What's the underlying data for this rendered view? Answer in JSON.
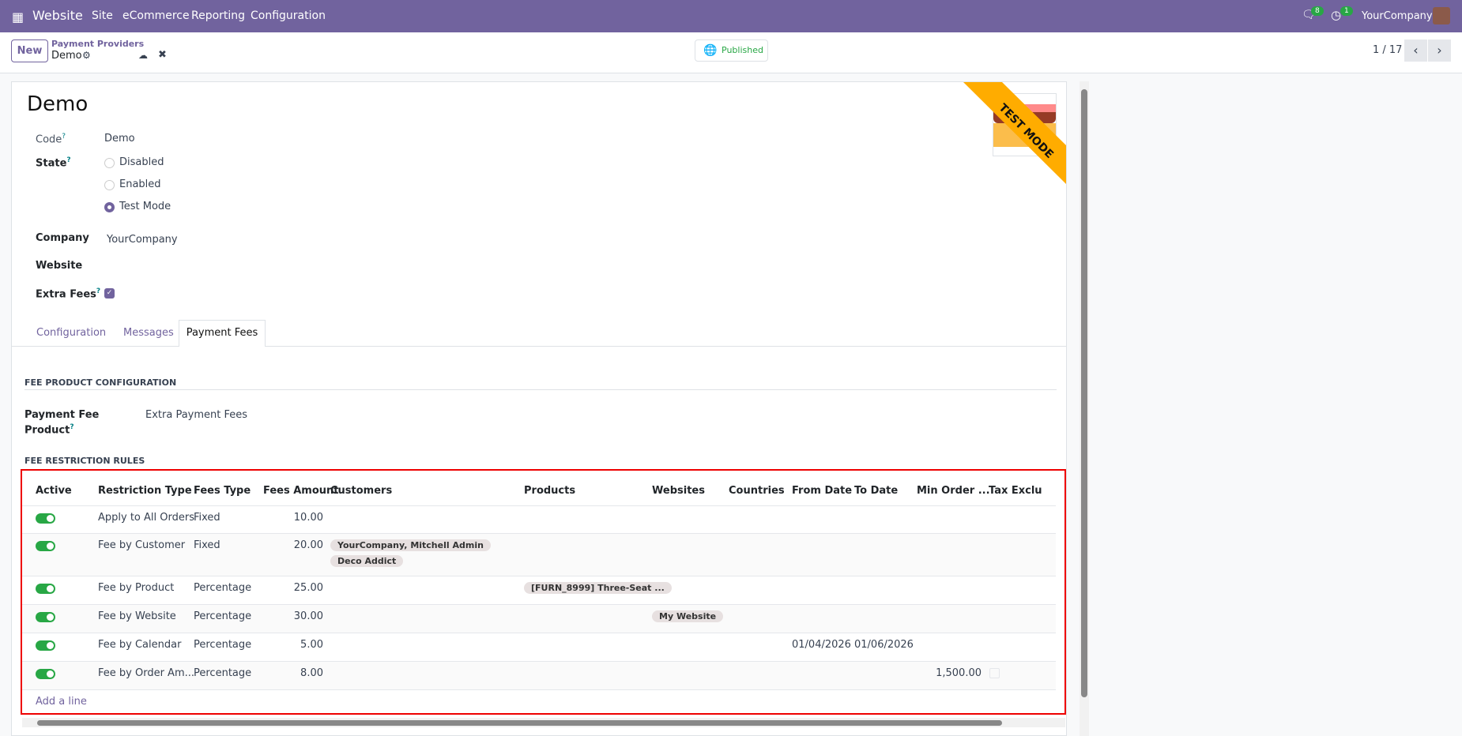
{
  "navbar": {
    "app": "Website",
    "menu": [
      "Site",
      "eCommerce",
      "Reporting",
      "Configuration"
    ],
    "messages_count": "8",
    "activities_count": "1",
    "company": "YourCompany"
  },
  "control": {
    "new_label": "New",
    "breadcrumb_parent": "Payment Providers",
    "breadcrumb_current": "Demo",
    "published_label": "Published",
    "pager": "1 / 17"
  },
  "form": {
    "title": "Demo",
    "ribbon": "TEST MODE",
    "code_label": "Code",
    "code_value": "Demo",
    "state_label": "State",
    "state_options": [
      "Disabled",
      "Enabled",
      "Test Mode"
    ],
    "state_selected": "Test Mode",
    "company_label": "Company",
    "company_value": "YourCompany",
    "website_label": "Website",
    "extra_fees_label": "Extra Fees",
    "extra_fees_checked": true,
    "tabs": [
      "Configuration",
      "Messages",
      "Payment Fees"
    ],
    "active_tab": "Payment Fees",
    "fee_product_section": "FEE PRODUCT CONFIGURATION",
    "payment_fee_label_1": "Payment Fee",
    "payment_fee_label_2": "Product",
    "payment_fee_value": "Extra Payment Fees",
    "rules_section": "FEE RESTRICTION RULES"
  },
  "table": {
    "headers": [
      "Active",
      "Restriction Type",
      "Fees Type",
      "Fees Amount",
      "Customers",
      "Products",
      "Websites",
      "Countries",
      "From Date",
      "To Date",
      "Min Order ...",
      "Tax Exclu"
    ],
    "rows": [
      {
        "active": true,
        "type": "Apply to All Orders",
        "fees_type": "Fixed",
        "amount": "10.00",
        "customers": [],
        "products": [],
        "websites": [],
        "from": "",
        "to": "",
        "min": "",
        "tax": false
      },
      {
        "active": true,
        "type": "Fee by Customer",
        "fees_type": "Fixed",
        "amount": "20.00",
        "customers": [
          "YourCompany, Mitchell Admin",
          "Deco Addict"
        ],
        "products": [],
        "websites": [],
        "from": "",
        "to": "",
        "min": "",
        "tax": false
      },
      {
        "active": true,
        "type": "Fee by Product",
        "fees_type": "Percentage",
        "amount": "25.00",
        "customers": [],
        "products": [
          "[FURN_8999] Three-Seat ..."
        ],
        "websites": [],
        "from": "",
        "to": "",
        "min": "",
        "tax": false
      },
      {
        "active": true,
        "type": "Fee by Website",
        "fees_type": "Percentage",
        "amount": "30.00",
        "customers": [],
        "products": [],
        "websites": [
          "My Website"
        ],
        "from": "",
        "to": "",
        "min": "",
        "tax": false
      },
      {
        "active": true,
        "type": "Fee by Calendar",
        "fees_type": "Percentage",
        "amount": "5.00",
        "customers": [],
        "products": [],
        "websites": [],
        "from": "01/04/2026",
        "to": "01/06/2026",
        "min": "",
        "tax": false
      },
      {
        "active": true,
        "type": "Fee by Order Am...",
        "fees_type": "Percentage",
        "amount": "8.00",
        "customers": [],
        "products": [],
        "websites": [],
        "from": "",
        "to": "",
        "min": "1,500.00",
        "tax": false
      }
    ],
    "add_line": "Add a line"
  }
}
